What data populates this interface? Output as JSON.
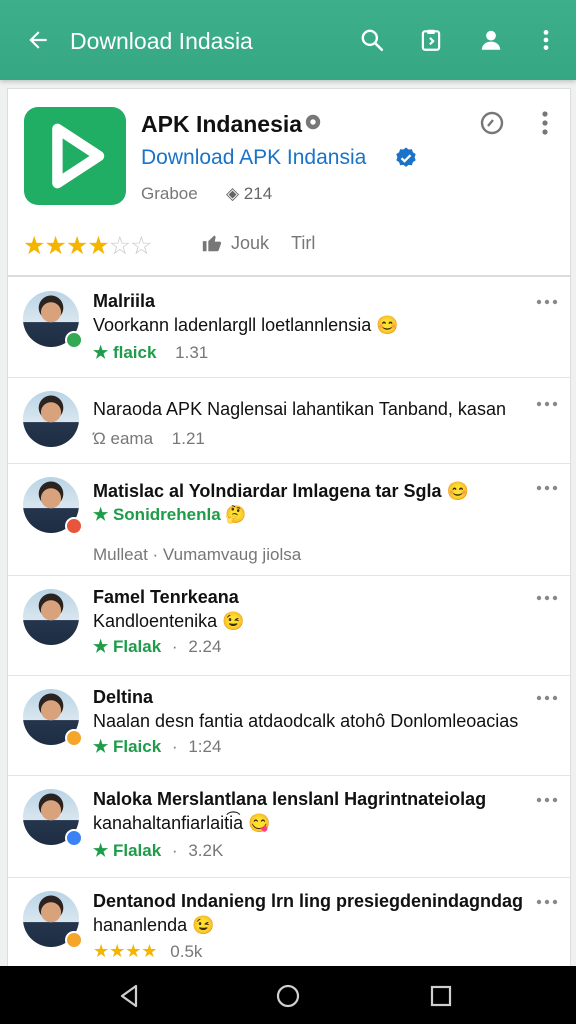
{
  "header": {
    "title": "Download Indasia",
    "back_icon": "arrow-left-icon",
    "search_icon": "search-icon",
    "clipboard_icon": "clipboard-icon",
    "account_icon": "account-icon",
    "more_icon": "more-vert-icon",
    "background": "#3daf8a"
  },
  "app_card": {
    "app_name": "APK Indanesia",
    "developer": "Download APK Indansia",
    "meta_left": "Graboe",
    "meta_right": "214",
    "rating": 3.5,
    "like_label": "Jouk",
    "like_label_2": "Tirl",
    "logo_color": "#1fae63",
    "link_color": "#1a73c8"
  },
  "comments": [
    {
      "name": "Malriila",
      "text": "Voorkann ladenlargll loetlannlensia 😊",
      "tag_label": "★ flaick",
      "tag_style": "green",
      "time": "1.31",
      "badge_color": "#34a853"
    },
    {
      "name": "Naraoda APK Naglensai lahantikan Tanband, kasan",
      "text": "",
      "tag_label": "Ώ eama",
      "tag_style": "gray",
      "time": "1.21",
      "badge_color": ""
    },
    {
      "name": "Matislac al Yolndiardar lmlagena tar Sgla 😊",
      "text": "",
      "tag_label": "★ Sonidrehenla 🤔",
      "tag_style": "green",
      "time": "",
      "extra": "Mulleat  ·  Vumamvaug jiolsa",
      "badge_color": "#e8553a"
    },
    {
      "name": "Famel Tenrkeana",
      "text": "Kandloentenika 😉",
      "tag_label": "★ Flalak",
      "tag_style": "green",
      "time": "2.24",
      "badge_color": ""
    },
    {
      "name": "Deltina",
      "text": "Naalan desn fantia atdaodcalk atohô Donlomleoacias",
      "tag_label": "★ Flaick",
      "tag_style": "green",
      "time": "1:24",
      "badge_color": "#f4a52a"
    },
    {
      "name": "Naloka Merslantlana lenslanl Hagrintnateiolag",
      "text": "kanahaltanfiarlaiti͡a 😋",
      "tag_label": "★ Flalak",
      "tag_style": "green",
      "time": "3.2K",
      "badge_color": "#3b82f6"
    },
    {
      "name": "Dentanod Indanieng lrn ling presiegdenindagndag",
      "text": "hananlenda 😉",
      "tag_label": "★★★★",
      "tag_style": "stars",
      "time": "0.5k",
      "badge_color": "#f4a52a"
    }
  ],
  "navbar": {
    "back_icon": "nav-back-icon",
    "home_icon": "nav-home-icon",
    "recents_icon": "nav-recents-icon"
  }
}
